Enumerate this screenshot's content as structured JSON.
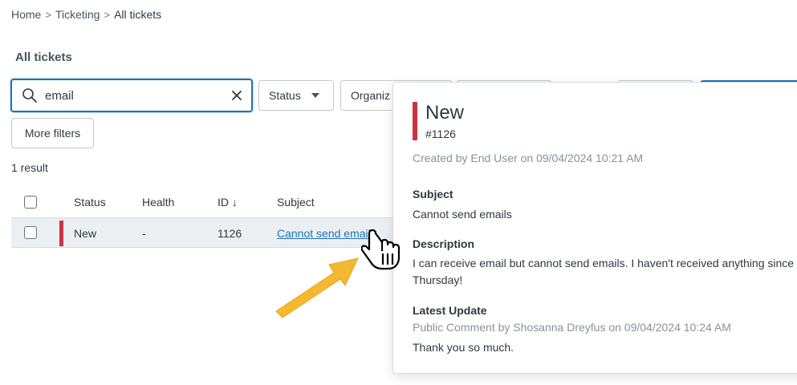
{
  "breadcrumb": {
    "items": [
      "Home",
      "Ticketing",
      "All tickets"
    ],
    "separator": ">"
  },
  "page": {
    "title": "All tickets"
  },
  "search": {
    "value": "email"
  },
  "filters": {
    "status_label": "Status",
    "organization_label": "Organiz",
    "more_filters_label": "More filters"
  },
  "results": {
    "count_text": "1 result"
  },
  "table": {
    "headers": {
      "status": "Status",
      "health": "Health",
      "id": "ID ↓",
      "subject": "Subject"
    },
    "rows": [
      {
        "status": "New",
        "health": "-",
        "id": "1126",
        "subject": "Cannot send emails",
        "status_color": "#cc3340"
      }
    ]
  },
  "popover": {
    "status": "New",
    "ticket_number": "#1126",
    "created": "Created by End User on 09/04/2024 10:21 AM",
    "subject_label": "Subject",
    "subject": "Cannot send emails",
    "description_label": "Description",
    "description": "I can receive email but cannot send emails. I haven't received anything since Thursday!",
    "update_label": "Latest Update",
    "update_meta": "Public Comment by Shosanna Dreyfus on 09/04/2024 10:24 AM",
    "update_text": "Thank you so much."
  },
  "colors": {
    "accent": "#1f73b7",
    "status_new": "#cc3340",
    "annotation_arrow": "#f5b931"
  },
  "icons": [
    "search-icon",
    "close-icon",
    "chevron-down-icon",
    "pointer-hand-icon",
    "arrow-annotation"
  ]
}
